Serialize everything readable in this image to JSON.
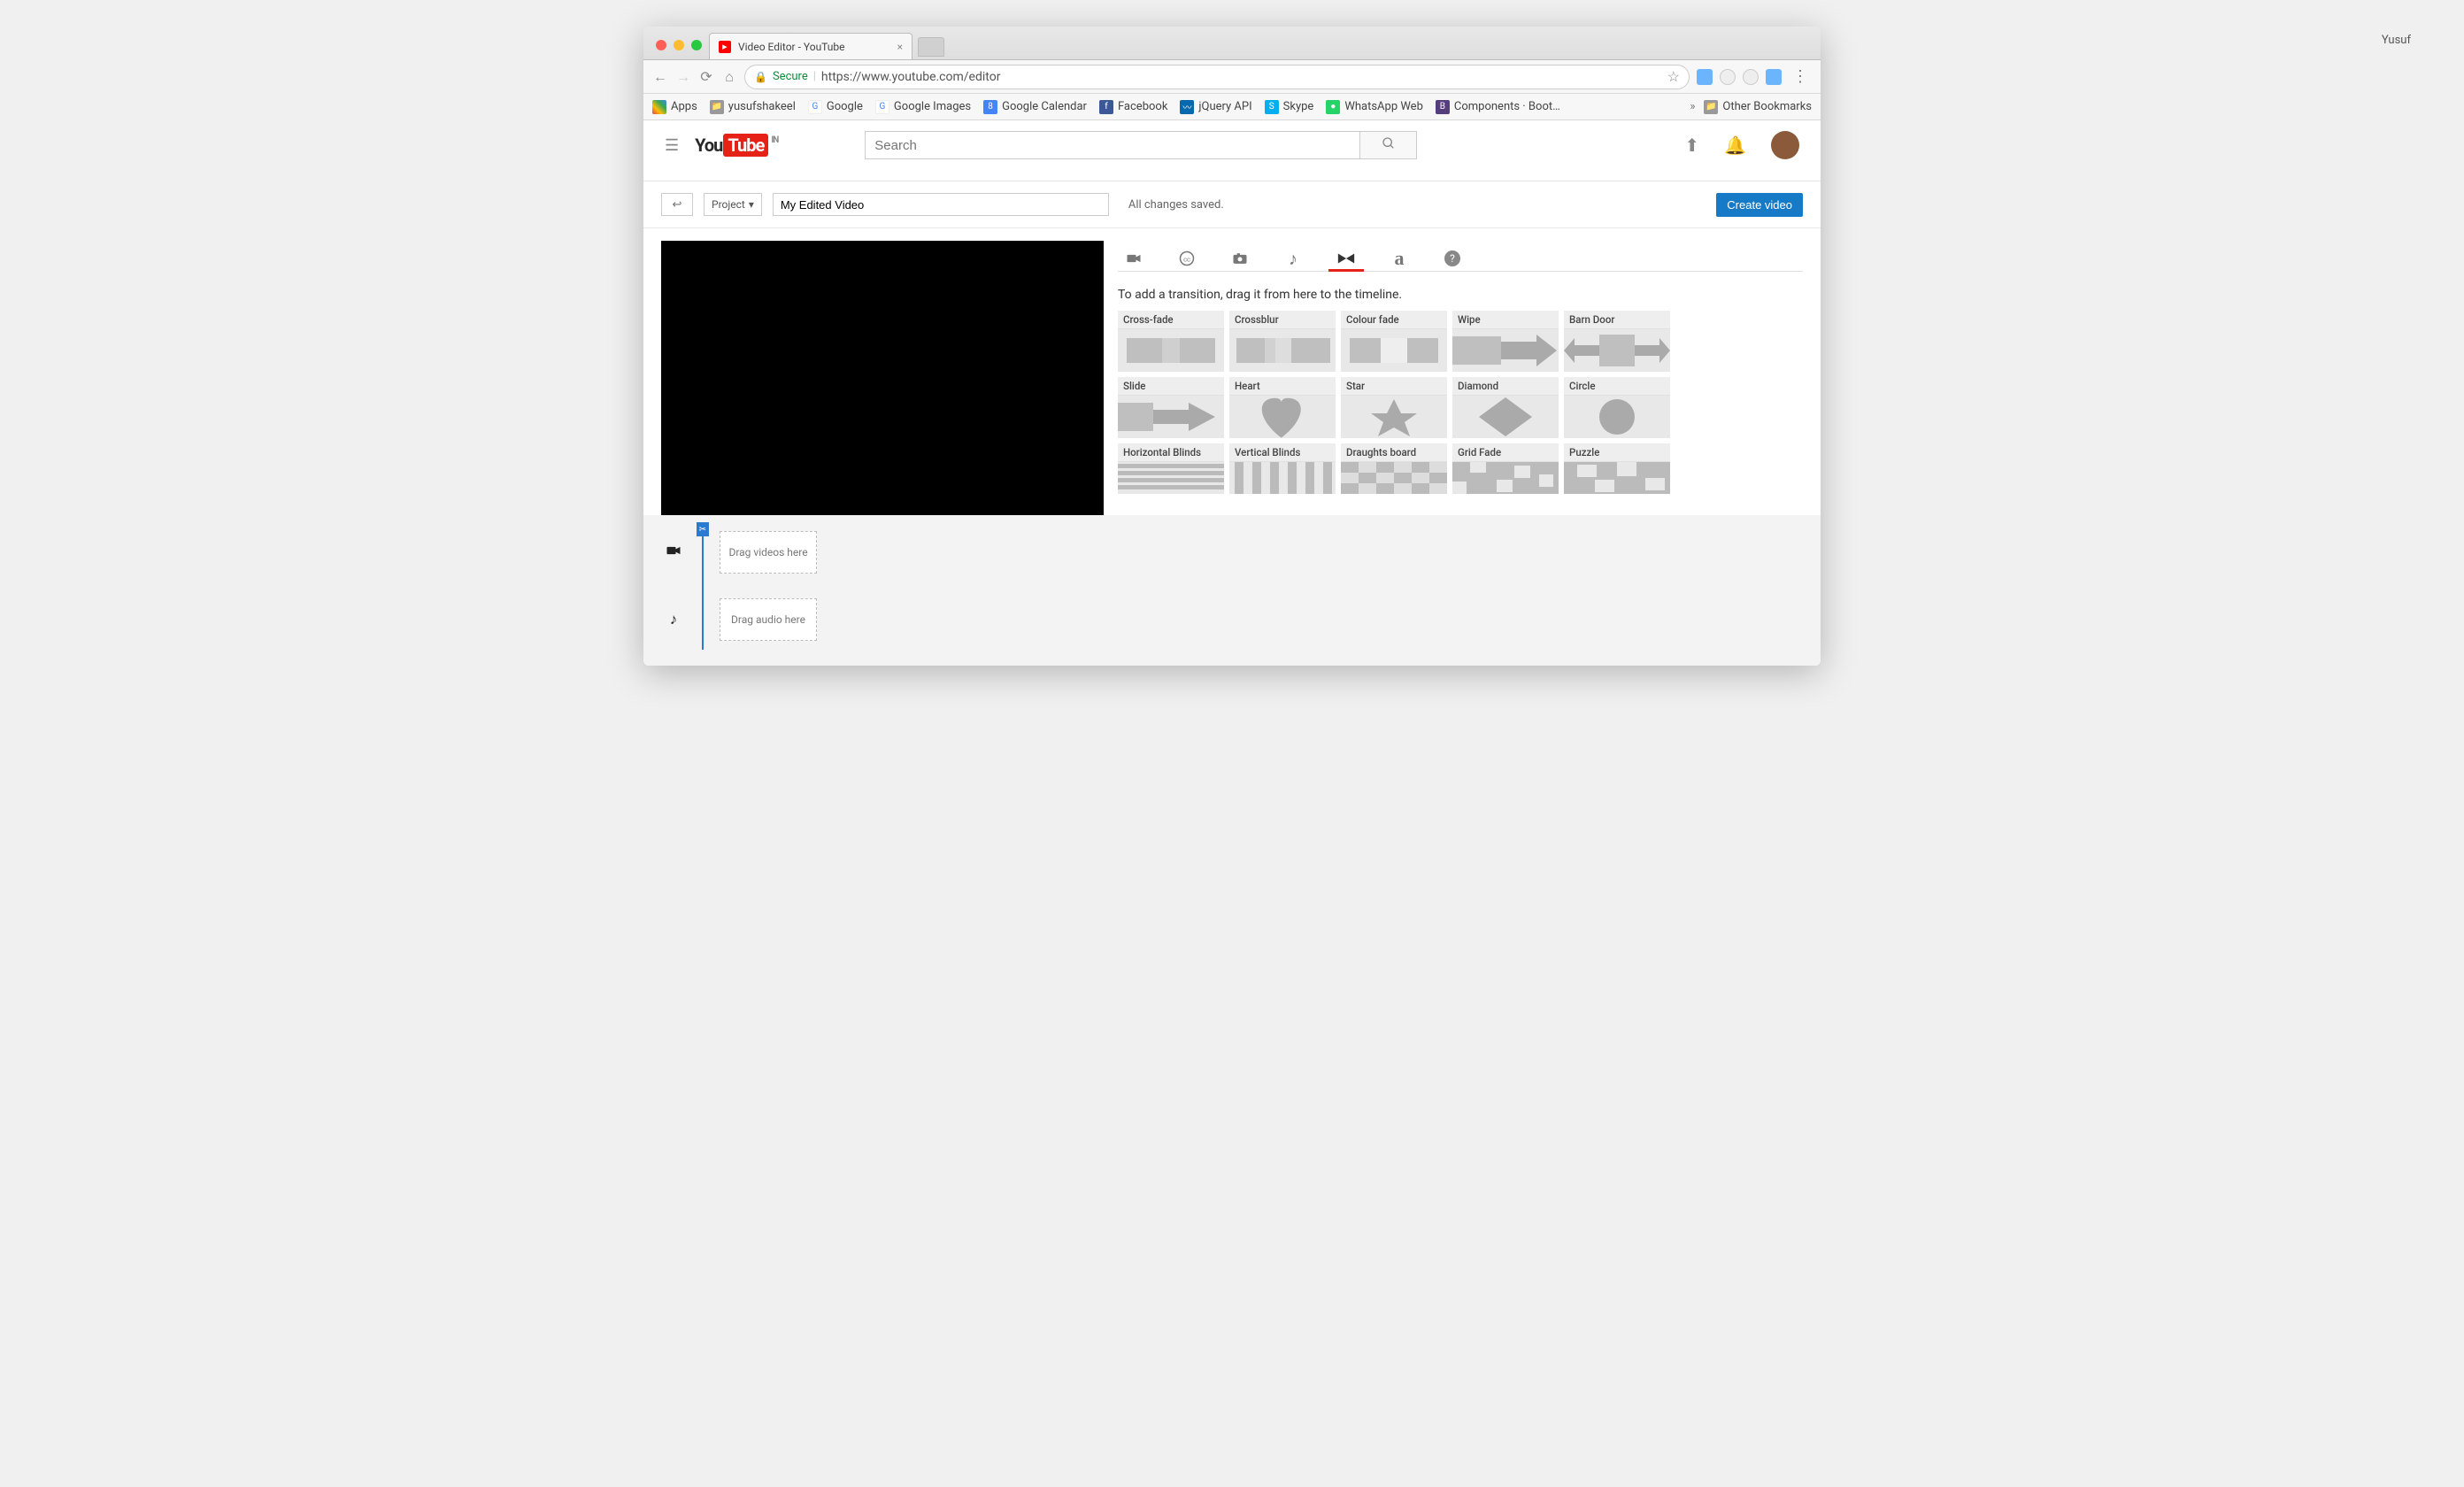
{
  "profile_user": "Yusuf",
  "tab": {
    "title": "Video Editor - YouTube"
  },
  "address": {
    "secure": "Secure",
    "url_display": "https://www.youtube.com/editor"
  },
  "bookmarks": {
    "apps": "Apps",
    "items": [
      "yusufshakeel",
      "Google",
      "Google Images",
      "Google Calendar",
      "Facebook",
      "jQuery API",
      "Skype",
      "WhatsApp Web",
      "Components · Boot…"
    ],
    "other": "Other Bookmarks"
  },
  "youtube": {
    "region": "IN",
    "search_placeholder": "Search"
  },
  "editor": {
    "project_dd": "Project",
    "project_title": "My Edited Video",
    "status": "All changes saved.",
    "create_btn": "Create video"
  },
  "transitions": {
    "instructions": "To add a transition, drag it from here to the timeline.",
    "items": [
      "Cross-fade",
      "Crossblur",
      "Colour fade",
      "Wipe",
      "Barn Door",
      "Slide",
      "Heart",
      "Star",
      "Diamond",
      "Circle",
      "Horizontal Blinds",
      "Vertical Blinds",
      "Draughts board",
      "Grid Fade",
      "Puzzle"
    ]
  },
  "timeline": {
    "video_drop": "Drag videos here",
    "audio_drop": "Drag audio here"
  }
}
